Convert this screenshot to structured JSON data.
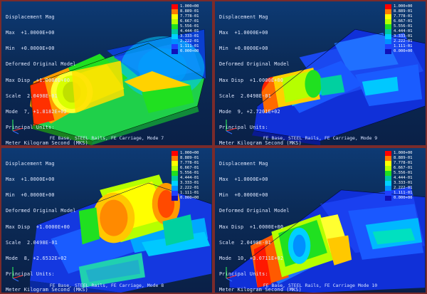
{
  "panels": [
    {
      "info": [
        "Displacement Mag",
        "Max  +1.0000E+00",
        "Min  +0.0000E+00",
        "Deformed Original Model",
        "Max Disp  +1.0000E+00",
        "Scale  2.0498E-01",
        "Mode  7, +1.8182E+02",
        "Principal Units:",
        "Meter Kilogram Second (MKS)"
      ],
      "legend": [
        "1.000+00",
        "8.889-01",
        "7.778-01",
        "6.667-01",
        "5.556-01",
        "4.444-01",
        "3.333-01",
        "2.222-01",
        "1.111-01",
        "0.000+00"
      ],
      "caption": "FE Base, STEEL Rails, FE Carriage, Mode 7"
    },
    {
      "info": [
        "Displacement Mag",
        "Max  +1.0000E+00",
        "Min  +0.0000E+00",
        "Deformed Original Model",
        "Max Disp  +1.0000E+00",
        "Scale  2.0498E-01",
        "Mode  9, +2.7201E+02",
        "Principal Units:",
        "Meter Kilogram Second (MKS)"
      ],
      "legend": [
        "1.000+00",
        "8.889-01",
        "7.778-01",
        "6.667-01",
        "5.556-01",
        "4.444-01",
        "3.333-01",
        "2.222-01",
        "1.111-01",
        "0.000+00"
      ],
      "caption": "FE Base, STEEL Rails, FE Carriage, Mode 9"
    },
    {
      "info": [
        "Displacement Mag",
        "Max  +1.0000E+00",
        "Min  +0.0000E+00",
        "Deformed Original Model",
        "Max Disp  +1.0000E+00",
        "Scale  2.0498E-01",
        "Mode  8, +2.6532E+02",
        "Principal Units:",
        "Meter Kilogram Second (MKS)"
      ],
      "legend": [
        "1.000+00",
        "8.889-01",
        "7.778-01",
        "6.667-01",
        "5.556-01",
        "4.444-01",
        "3.333-01",
        "2.222-01",
        "1.111-01",
        "0.000+00"
      ],
      "caption": "FE Base, STEEL Rails, FE Carriage, Mode 8"
    },
    {
      "info": [
        "Displacement Mag",
        "Max  +1.0000E+00",
        "Min  +0.0000E+00",
        "Deformed Original Model",
        "Max Disp  +1.0000E+00",
        "Scale  2.0498E-01",
        "Mode  10, +3.0711E+02",
        "Principal Units:",
        "Meter Kilogram Second (MKS)"
      ],
      "legend": [
        "1.000+00",
        "8.889-01",
        "7.778-01",
        "6.667-01",
        "5.556-01",
        "4.444-01",
        "3.333-01",
        "2.222-01",
        "1.111-01",
        "0.000+00"
      ],
      "caption": "FE Base, STEEL Rails, FE Carriage Mode 10"
    }
  ],
  "legend_colors": [
    "#ff0000",
    "#ff7a00",
    "#ffff00",
    "#b6ff00",
    "#20e020",
    "#00c8a0",
    "#00d0ff",
    "#0090ff",
    "#2040ff",
    "#1010b8"
  ],
  "icons": {
    "triad": "axis-triad-icon"
  }
}
